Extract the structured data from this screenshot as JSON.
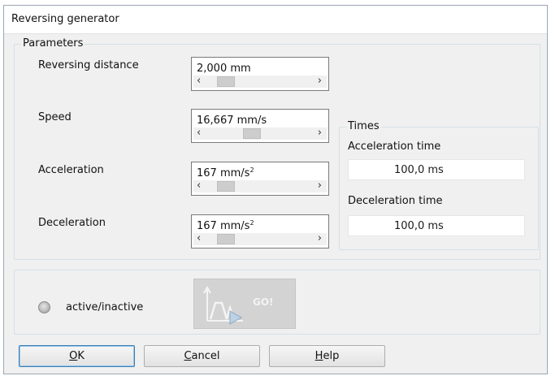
{
  "window": {
    "title": "Reversing generator"
  },
  "parameters": {
    "legend": "Parameters",
    "fields": [
      {
        "label": "Reversing distance",
        "value": "2,000 mm",
        "unit_sup": "",
        "slider_fraction": 0.12
      },
      {
        "label": "Speed",
        "value": "16,667 mm/s",
        "unit_sup": "",
        "slider_fraction": 0.42
      },
      {
        "label": "Acceleration",
        "value": "167 mm/s",
        "unit_sup": "2",
        "slider_fraction": 0.12
      },
      {
        "label": "Deceleration",
        "value": "167 mm/s",
        "unit_sup": "2",
        "slider_fraction": 0.12
      }
    ]
  },
  "times": {
    "legend": "Times",
    "acceleration_label": "Acceleration time",
    "acceleration_value": "100,0 ms",
    "deceleration_label": "Deceleration time",
    "deceleration_value": "100,0 ms"
  },
  "control": {
    "status_label": "active/inactive",
    "go_label": "GO!"
  },
  "buttons": {
    "ok": {
      "mnemonic": "O",
      "rest": "K"
    },
    "cancel": {
      "mnemonic": "C",
      "rest": "ancel"
    },
    "help": {
      "mnemonic": "H",
      "rest": "elp"
    }
  },
  "colors": {
    "dialog_bg": "#f0f0f0",
    "default_button_border": "#3c7fb1",
    "go_button_disabled": "#d3d3d3"
  },
  "icons": [
    "left-arrow-icon",
    "right-arrow-icon",
    "radio-indicator-icon",
    "motion-profile-icon"
  ]
}
